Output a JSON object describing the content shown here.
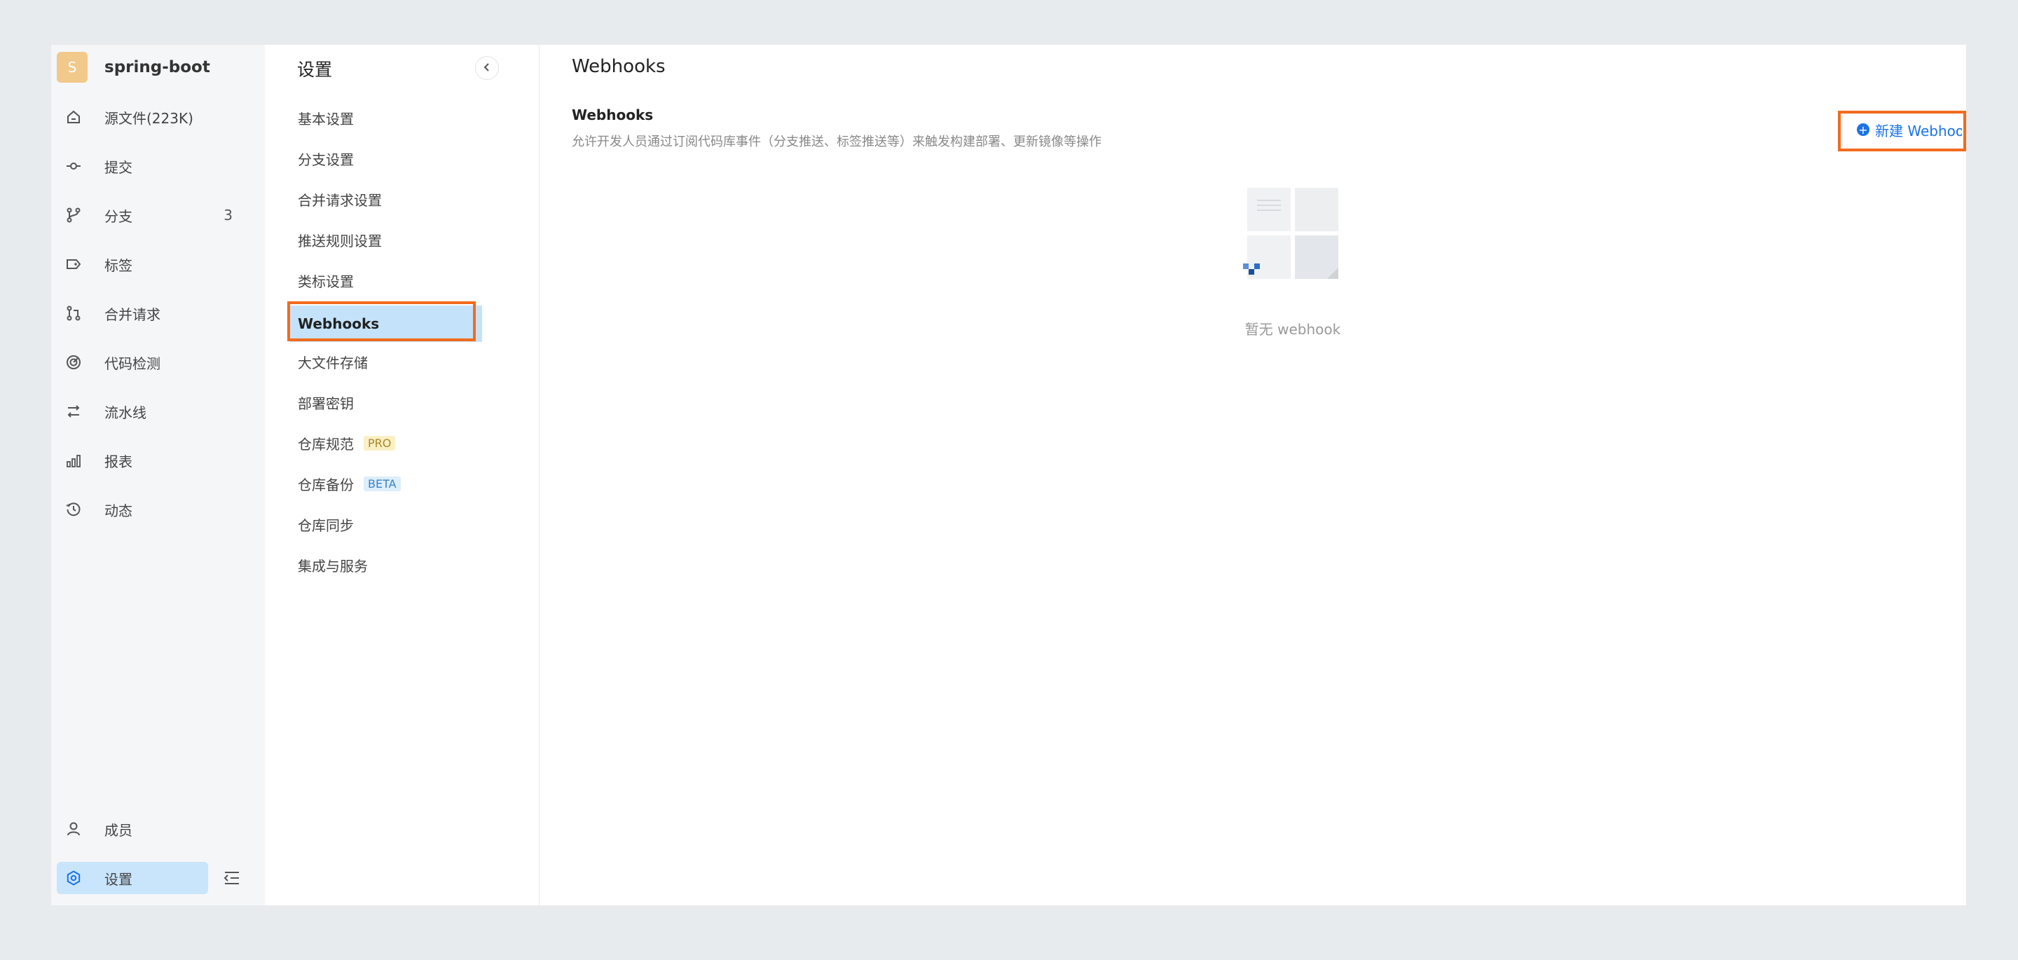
{
  "repo": {
    "avatar_letter": "S",
    "name": "spring-boot"
  },
  "sidebar": {
    "items": [
      {
        "label": "源文件(223K)",
        "icon": "home-icon"
      },
      {
        "label": "提交",
        "icon": "commit-icon"
      },
      {
        "label": "分支",
        "icon": "branch-icon",
        "count": "3"
      },
      {
        "label": "标签",
        "icon": "tag-icon"
      },
      {
        "label": "合并请求",
        "icon": "merge-request-icon"
      },
      {
        "label": "代码检测",
        "icon": "scan-icon"
      },
      {
        "label": "流水线",
        "icon": "pipeline-icon"
      },
      {
        "label": "报表",
        "icon": "chart-icon"
      },
      {
        "label": "动态",
        "icon": "history-icon"
      }
    ],
    "bottom": [
      {
        "label": "成员",
        "icon": "user-icon"
      },
      {
        "label": "设置",
        "icon": "settings-icon"
      }
    ]
  },
  "settings": {
    "title": "设置",
    "items": [
      {
        "label": "基本设置"
      },
      {
        "label": "分支设置"
      },
      {
        "label": "合并请求设置"
      },
      {
        "label": "推送规则设置"
      },
      {
        "label": "类标设置"
      },
      {
        "label": "Webhooks"
      },
      {
        "label": "大文件存储"
      },
      {
        "label": "部署密钥"
      },
      {
        "label": "仓库规范",
        "tag": "PRO"
      },
      {
        "label": "仓库备份",
        "tag": "BETA"
      },
      {
        "label": "仓库同步"
      },
      {
        "label": "集成与服务"
      }
    ]
  },
  "main": {
    "page_title": "Webhooks",
    "section_title": "Webhooks",
    "section_desc": "允许开发人员通过订阅代码库事件（分支推送、标签推送等）来触发构建部署、更新镜像等操作",
    "new_button": "新建 Webhook",
    "empty_text": "暂无 webhook"
  },
  "colors": {
    "accent": "#1a73e8",
    "active_bg": "#c4e3fa",
    "highlight": "#f26b1d"
  }
}
